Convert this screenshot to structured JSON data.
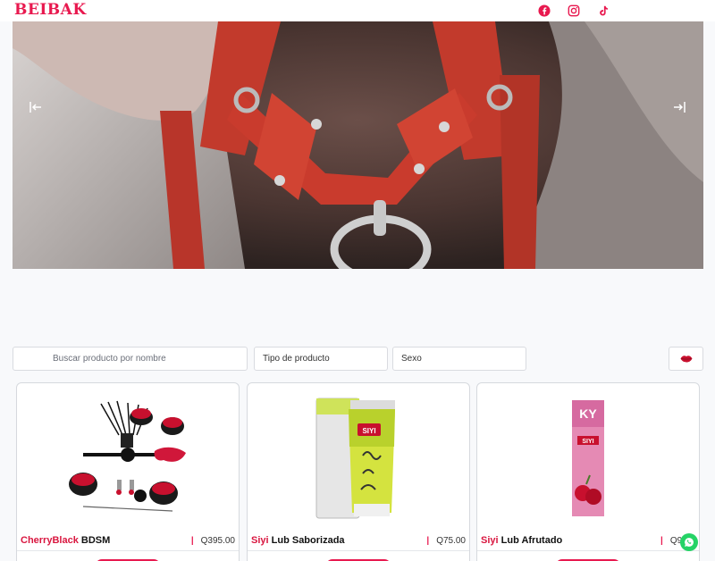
{
  "brand": {
    "logo_text": "BEIBAK",
    "accent": "#e8194f"
  },
  "header": {
    "social": [
      {
        "icon": "facebook-icon"
      },
      {
        "icon": "instagram-icon"
      },
      {
        "icon": "tiktok-icon"
      }
    ]
  },
  "hero": {
    "prev_icon": "arrow-left-bar-icon",
    "next_icon": "arrow-right-bar-icon"
  },
  "filters": {
    "search_placeholder": "Buscar producto por nombre",
    "type_label": "Tipo de producto",
    "sex_label": "Sexo",
    "extra_icon": "lips-icon"
  },
  "products": [
    {
      "brand": "CherryBlack",
      "name": "BDSM",
      "price": "Q395.00"
    },
    {
      "brand": "Siyi",
      "name": "Lub Saborizada",
      "price": "Q75.00"
    },
    {
      "brand": "Siyi",
      "name": "Lub Afrutado",
      "price": "Q9"
    }
  ],
  "floating": {
    "icon": "whatsapp-icon",
    "color": "#25d366"
  }
}
